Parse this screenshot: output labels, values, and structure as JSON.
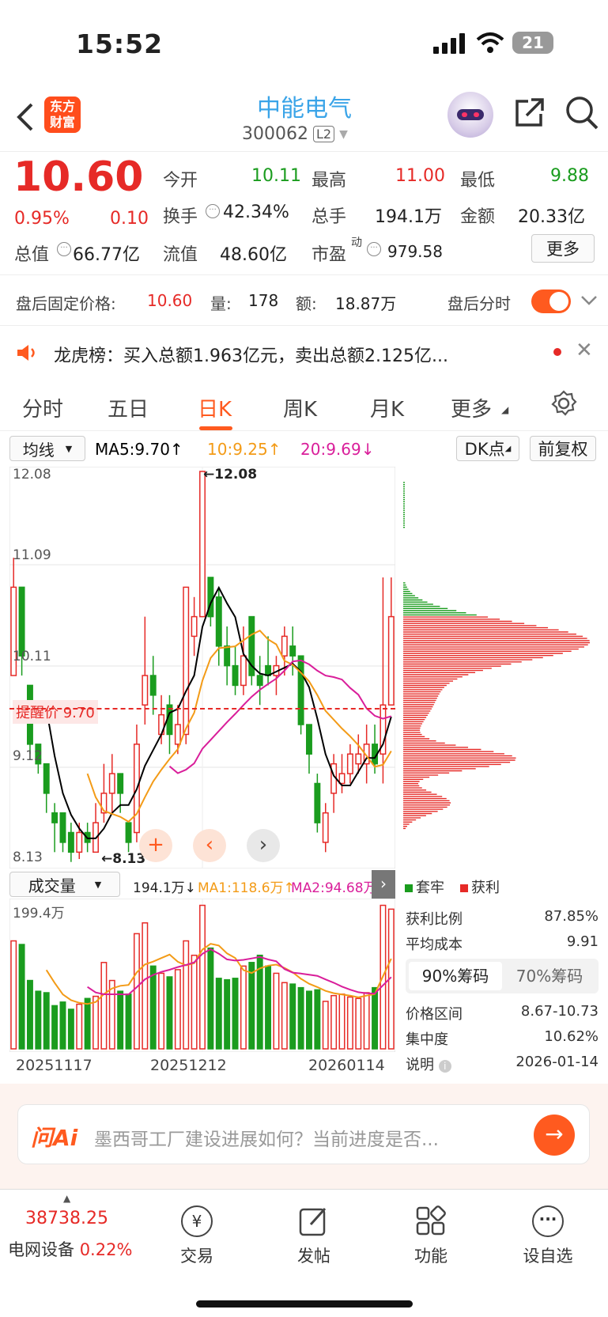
{
  "status": {
    "time": "15:52",
    "battery": "21"
  },
  "header": {
    "logo_line1": "东方",
    "logo_line2": "财富",
    "title": "中能电气",
    "code": "300062",
    "level": "L2"
  },
  "quote": {
    "price": "10.60",
    "change_pct": "0.95%",
    "change": "0.10",
    "open_label": "今开",
    "open": "10.11",
    "high_label": "最高",
    "high": "11.00",
    "low_label": "最低",
    "low": "9.88",
    "turnover_label": "换手",
    "turnover": "42.34%",
    "volume_label": "总手",
    "volume": "194.1万",
    "amount_label": "金额",
    "amount": "20.33亿",
    "mktcap_label": "总值",
    "mktcap": "66.77亿",
    "float_label": "流值",
    "float": "48.60亿",
    "pe_label": "市盈",
    "pe_sup": "动",
    "pe": "979.58",
    "more_label": "更多"
  },
  "afterhours": {
    "label": "盘后固定价格:",
    "price": "10.60",
    "vol_label": "量:",
    "vol": "178",
    "amt_label": "额:",
    "amt": "18.87万",
    "toggle_label": "盘后分时"
  },
  "notice": {
    "text": "龙虎榜：买入总额1.963亿元，卖出总额2.125亿..."
  },
  "tabs": [
    "分时",
    "五日",
    "日K",
    "周K",
    "月K",
    "更多"
  ],
  "chart_toolbar": {
    "ma_select": "均线",
    "ma5": "MA5:9.70↑",
    "ma10": "10:9.25↑",
    "ma20": "20:9.69↓",
    "dk_label": "DK点",
    "adj_label": "前复权"
  },
  "price_axis": {
    "top": "12.08",
    "l2": "11.09",
    "l3": "10.11",
    "l4": "9.12",
    "bottom": "8.13",
    "max_label": "←12.08",
    "min_label": "←8.13",
    "alert_label": "提醒价 9.70"
  },
  "volume_toolbar": {
    "select": "成交量",
    "vol": "194.1万↓",
    "ma1": "MA1:118.6万↑",
    "ma2": "MA2:94.68万",
    "vmax": "199.4万"
  },
  "dates": [
    "20251117",
    "20251212",
    "20260114"
  ],
  "chips": {
    "legend_trapped": "套牢",
    "legend_profit": "获利",
    "profit_ratio_label": "获利比例",
    "profit_ratio": "87.85%",
    "avg_cost_label": "平均成本",
    "avg_cost": "9.91",
    "tab90": "90%筹码",
    "tab70": "70%筹码",
    "range_label": "价格区间",
    "range": "8.67-10.73",
    "conc_label": "集中度",
    "conc": "10.62%",
    "note_label": "说明",
    "note": "2026-01-14"
  },
  "ai": {
    "brand": "问Ai",
    "placeholder": "墨西哥工厂建设进展如何？当前进度是否..."
  },
  "bottom": {
    "index_value": "38738.25",
    "index_name": "电网设备",
    "index_pct": "0.22%",
    "trade": "交易",
    "post": "发帖",
    "func": "功能",
    "watch": "设自选"
  },
  "colors": {
    "up": "#e62a27",
    "down": "#1a9c1e",
    "ma5": "#000000",
    "ma10": "#f39b17",
    "ma20": "#d91e9a",
    "accent": "#ff5a1f"
  },
  "chart_data": {
    "type": "candlestick",
    "candles": [
      [
        10.0,
        10.9,
        11.2,
        10.0
      ],
      [
        10.9,
        10.2,
        10.9,
        10.0
      ],
      [
        9.9,
        9.3,
        9.9,
        9.2
      ],
      [
        9.3,
        9.1,
        9.3,
        9.0
      ],
      [
        9.1,
        8.8,
        9.1,
        8.6
      ],
      [
        8.6,
        8.5,
        8.7,
        8.2
      ],
      [
        8.6,
        8.3,
        8.6,
        8.2
      ],
      [
        8.4,
        8.2,
        8.5,
        8.1
      ],
      [
        8.2,
        8.4,
        8.5,
        8.13
      ],
      [
        8.4,
        8.3,
        8.5,
        8.2
      ],
      [
        8.2,
        8.5,
        8.7,
        8.2
      ],
      [
        8.6,
        8.8,
        9.1,
        8.5
      ],
      [
        8.8,
        9.0,
        9.2,
        8.6
      ],
      [
        9.0,
        8.8,
        9.0,
        8.6
      ],
      [
        8.5,
        8.3,
        8.5,
        8.2
      ],
      [
        8.4,
        9.3,
        9.5,
        8.3
      ],
      [
        9.7,
        10.0,
        10.6,
        9.5
      ],
      [
        10.0,
        9.8,
        10.2,
        9.6
      ],
      [
        9.4,
        9.6,
        9.8,
        9.3
      ],
      [
        9.7,
        9.4,
        9.8,
        9.2
      ],
      [
        9.3,
        9.5,
        9.7,
        9.2
      ],
      [
        9.4,
        10.9,
        10.9,
        9.3
      ],
      [
        10.4,
        10.6,
        10.8,
        10.2
      ],
      [
        10.6,
        12.08,
        12.08,
        10.6
      ],
      [
        11.0,
        10.6,
        11.0,
        10.5
      ],
      [
        10.8,
        10.3,
        10.9,
        10.1
      ],
      [
        10.3,
        10.1,
        10.5,
        9.9
      ],
      [
        10.1,
        9.9,
        10.3,
        9.8
      ],
      [
        9.9,
        10.2,
        10.5,
        9.8
      ],
      [
        10.6,
        10.0,
        10.6,
        9.9
      ],
      [
        10.0,
        9.9,
        10.2,
        9.7
      ],
      [
        10.1,
        10.0,
        10.4,
        9.9
      ],
      [
        10.0,
        10.1,
        10.2,
        9.8
      ],
      [
        10.2,
        10.4,
        10.5,
        10.0
      ],
      [
        10.3,
        10.2,
        10.5,
        10.0
      ],
      [
        10.2,
        9.5,
        10.2,
        9.4
      ],
      [
        9.5,
        9.2,
        9.5,
        9.0
      ],
      [
        8.9,
        8.5,
        9.0,
        8.4
      ],
      [
        8.3,
        8.6,
        8.7,
        8.2
      ],
      [
        8.8,
        9.1,
        9.2,
        8.6
      ],
      [
        8.9,
        9.0,
        9.2,
        8.8
      ],
      [
        9.0,
        9.2,
        9.3,
        8.9
      ],
      [
        9.1,
        9.2,
        9.4,
        9.0
      ],
      [
        9.1,
        9.3,
        9.5,
        8.9
      ],
      [
        9.3,
        9.1,
        9.5,
        9.0
      ],
      [
        9.2,
        9.7,
        11.0,
        8.9
      ],
      [
        9.7,
        10.6,
        11.0,
        9.88
      ]
    ],
    "volumes": [
      150,
      145,
      95,
      80,
      78,
      60,
      65,
      55,
      62,
      70,
      73,
      120,
      95,
      80,
      76,
      160,
      175,
      115,
      105,
      100,
      110,
      150,
      130,
      199.4,
      140,
      98,
      96,
      98,
      115,
      120,
      130,
      115,
      105,
      92,
      90,
      85,
      80,
      82,
      66,
      74,
      76,
      72,
      70,
      78,
      85,
      199.4,
      194.1
    ],
    "ylim": [
      8.13,
      12.08
    ]
  }
}
